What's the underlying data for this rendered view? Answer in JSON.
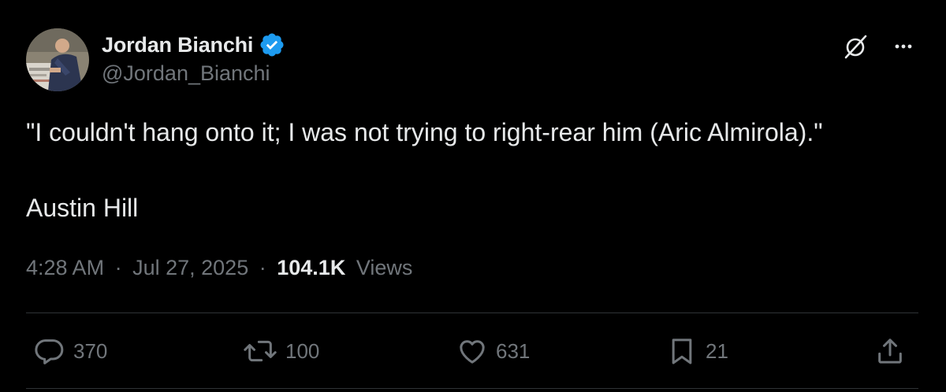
{
  "author": {
    "display_name": "Jordan Bianchi",
    "handle": "@Jordan_Bianchi",
    "verified": true,
    "verified_color": "#1d9bf0"
  },
  "tweet": {
    "line1": "\"I couldn't hang onto it; I was not trying to right-rear him (Aric Almirola).\"",
    "line2": "Austin Hill"
  },
  "meta": {
    "time": "4:28 AM",
    "separator": "·",
    "date": "Jul 27, 2025",
    "views_count": "104.1K",
    "views_label": "Views"
  },
  "actions": {
    "replies": "370",
    "reposts": "100",
    "likes": "631",
    "bookmarks": "21"
  },
  "icons": {
    "top": [
      "grok-icon",
      "more-icon"
    ],
    "actions": [
      "reply-icon",
      "repost-icon",
      "like-icon",
      "bookmark-icon",
      "share-icon"
    ]
  },
  "colors": {
    "background": "#000000",
    "text": "#e7e9ea",
    "secondary": "#71767b",
    "border": "#2f3336",
    "accent": "#1d9bf0"
  }
}
